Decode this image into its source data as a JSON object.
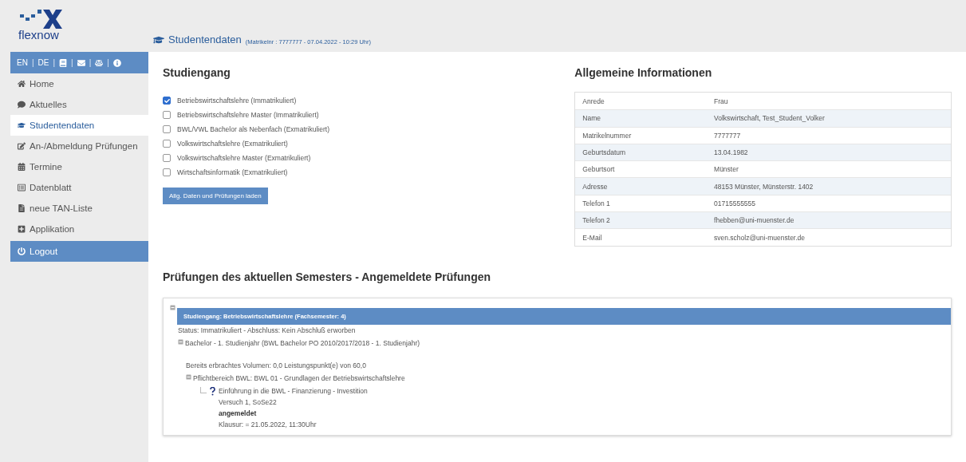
{
  "logo": {
    "text": "flexnow"
  },
  "header": {
    "title": "Studentendaten",
    "subtitle": "(Matrikelnr : 7777777 - 07.04.2022 - 10:29 Uhr)"
  },
  "sidebar": {
    "toolbar": [
      "EN",
      "DE"
    ],
    "separator": "|",
    "items": [
      {
        "label": "Home",
        "kind": "link",
        "selected": false
      },
      {
        "label": "Aktuelles",
        "kind": "link",
        "selected": false
      },
      {
        "label": "Studentendaten",
        "kind": "link",
        "selected": true
      },
      {
        "label": "An-/Abmeldung Prüfungen",
        "kind": "link",
        "selected": false
      },
      {
        "label": "Termine",
        "kind": "link",
        "selected": false
      },
      {
        "label": "Datenblatt",
        "kind": "link",
        "selected": false
      },
      {
        "label": "neue TAN-Liste",
        "kind": "link",
        "selected": false
      },
      {
        "label": "Applikation",
        "kind": "link",
        "selected": false
      },
      {
        "label": "Logout",
        "kind": "logout",
        "selected": false
      }
    ]
  },
  "studiengang": {
    "title": "Studiengang",
    "options": [
      {
        "label": "Betriebswirtschaftslehre (Immatrikuliert)",
        "checked": true
      },
      {
        "label": "Betriebswirtschaftslehre Master (Immatrikuliert)",
        "checked": false
      },
      {
        "label": "BWL/VWL Bachelor als Nebenfach (Exmatrikuliert)",
        "checked": false
      },
      {
        "label": "Volkswirtschaftslehre (Exmatrikuliert)",
        "checked": false
      },
      {
        "label": "Volkswirtschaftslehre Master (Exmatrikuliert)",
        "checked": false
      },
      {
        "label": "Wirtschaftsinformatik (Exmatrikuliert)",
        "checked": false
      }
    ],
    "button": "Allg. Daten und Prüfungen laden"
  },
  "info": {
    "title": "Allgemeine Informationen",
    "rows": [
      [
        "Anrede",
        "Frau"
      ],
      [
        "Name",
        "Volkswirtschaft, Test_Student_Volker"
      ],
      [
        "Matrikelnummer",
        "7777777"
      ],
      [
        "Geburtsdatum",
        "13.04.1982"
      ],
      [
        "Geburtsort",
        "Münster"
      ],
      [
        "Adresse",
        "48153 Münster, Münsterstr. 1402"
      ],
      [
        "Telefon 1",
        "01715555555"
      ],
      [
        "Telefon 2",
        "fhebben@uni-muenster.de"
      ],
      [
        "E-Mail",
        "sven.scholz@uni-muenster.de"
      ]
    ]
  },
  "exams": {
    "title": "Prüfungen des aktuellen Semesters - Angemeldete Prüfungen",
    "tree": [
      {
        "label": "Studiengang: Betriebswirtschaftslehre (Fachsemester: 4)",
        "expanded": true,
        "note": "Status: Immatrikuliert - Abschluss: Kein Abschluß erworben",
        "children": [
          {
            "label": "Bachelor - 1. Studienjahr (BWL Bachelor PO 2010/2017/2018 - 1. Studienjahr)",
            "expanded": true,
            "note": "Bereits erbrachtes Volumen: 0,0 Leistungspunkt(e) von 60,0",
            "children": [
              {
                "label": "Pflichtbereich BWL: BWL 01 - Grundlagen der Betriebswirtschaftslehre",
                "expanded": true,
                "exams": [
                  {
                    "title": "Einführung in die BWL - Finanzierung - Investition",
                    "attempt": "Versuch 1, SoSe22",
                    "status": "angemeldet",
                    "date": "Klausur: = 21.05.2022, 11:30Uhr"
                  }
                ]
              }
            ]
          }
        ]
      }
    ]
  }
}
